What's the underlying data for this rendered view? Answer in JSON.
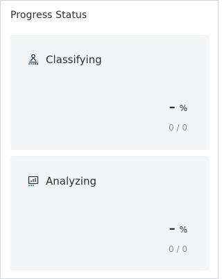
{
  "panel": {
    "title": "Progress Status"
  },
  "cards": [
    {
      "label": "Classifying",
      "icon": "hierarchy-icon",
      "percent": "–",
      "unit": "%",
      "count": "0 / 0"
    },
    {
      "label": "Analyzing",
      "icon": "analytics-chart-icon",
      "percent": "–",
      "unit": "%",
      "count": "0 / 0"
    }
  ],
  "colors": {
    "accent": "#2f6fed",
    "card_bg": "#f4f5f7",
    "border": "#d3d5d9",
    "muted_text": "#8b8f96"
  }
}
